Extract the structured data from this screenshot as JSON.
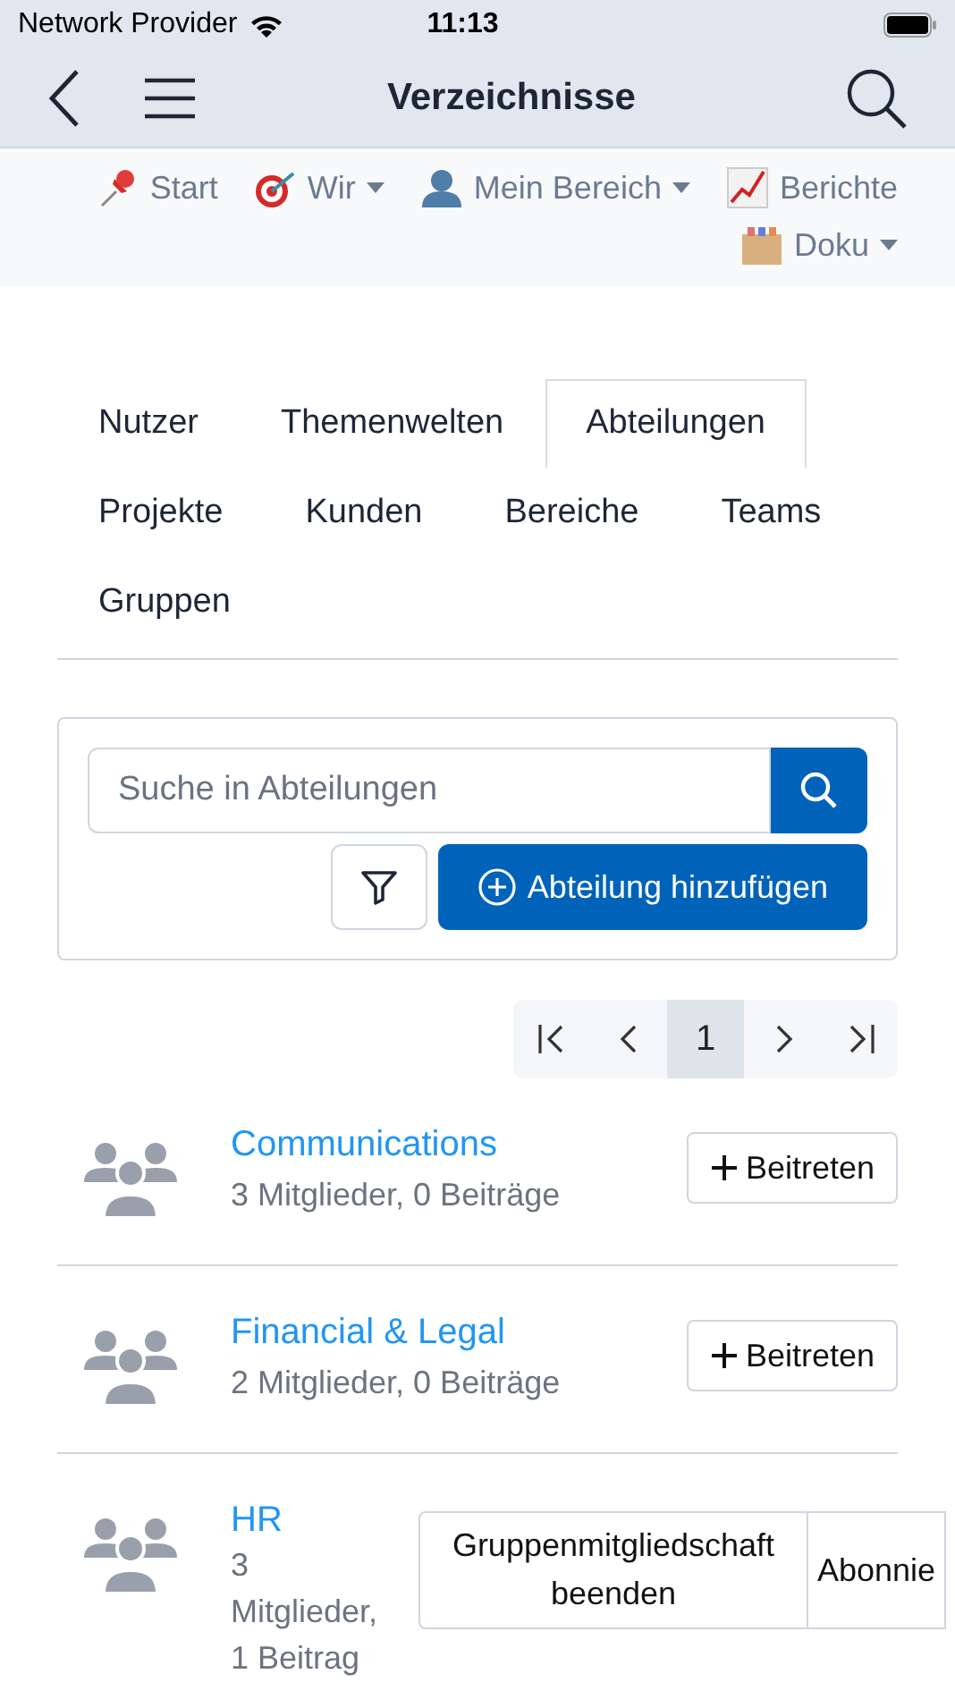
{
  "status_bar": {
    "carrier": "Network Provider",
    "time": "11:13"
  },
  "header": {
    "title": "Verzeichnisse"
  },
  "menu": [
    {
      "label": "Start",
      "kind": "pin",
      "dropdown": false
    },
    {
      "label": "Wir",
      "kind": "target",
      "dropdown": true
    },
    {
      "label": "Mein Bereich",
      "kind": "person",
      "dropdown": true
    },
    {
      "label": "Berichte",
      "kind": "chart",
      "dropdown": false
    },
    {
      "label": "Doku",
      "kind": "box",
      "dropdown": true
    }
  ],
  "tabs": [
    {
      "label": "Nutzer",
      "selected": false
    },
    {
      "label": "Themenwelten",
      "selected": false
    },
    {
      "label": "Abteilungen",
      "selected": true
    },
    {
      "label": "Projekte",
      "selected": false
    },
    {
      "label": "Kunden",
      "selected": false
    },
    {
      "label": "Bereiche",
      "selected": false
    },
    {
      "label": "Teams",
      "selected": false
    },
    {
      "label": "Gruppen",
      "selected": false
    }
  ],
  "search": {
    "placeholder": "Suche in Abteilungen",
    "add_button": "Abteilung hinzufügen"
  },
  "pagination": [
    {
      "kind": "first"
    },
    {
      "kind": "prev"
    },
    {
      "kind": "page",
      "label": "1",
      "selected": true
    },
    {
      "kind": "next"
    },
    {
      "kind": "last"
    }
  ],
  "departments": [
    {
      "name": "Communications",
      "meta": "3 Mitglieder, 0 Beiträge",
      "actions": [
        {
          "kind": "join",
          "label": "Beitreten"
        }
      ]
    },
    {
      "name": "Financial & Legal",
      "meta": "2 Mitglieder, 0 Beiträge",
      "actions": [
        {
          "kind": "join",
          "label": "Beitreten"
        }
      ]
    },
    {
      "name": "HR",
      "meta": "3 Mitglieder, 1 Beitrag",
      "actions": [
        {
          "kind": "plain",
          "label": "Gruppenmitgliedschaft beenden"
        },
        {
          "kind": "plain",
          "label": "Abonnie"
        }
      ]
    }
  ]
}
